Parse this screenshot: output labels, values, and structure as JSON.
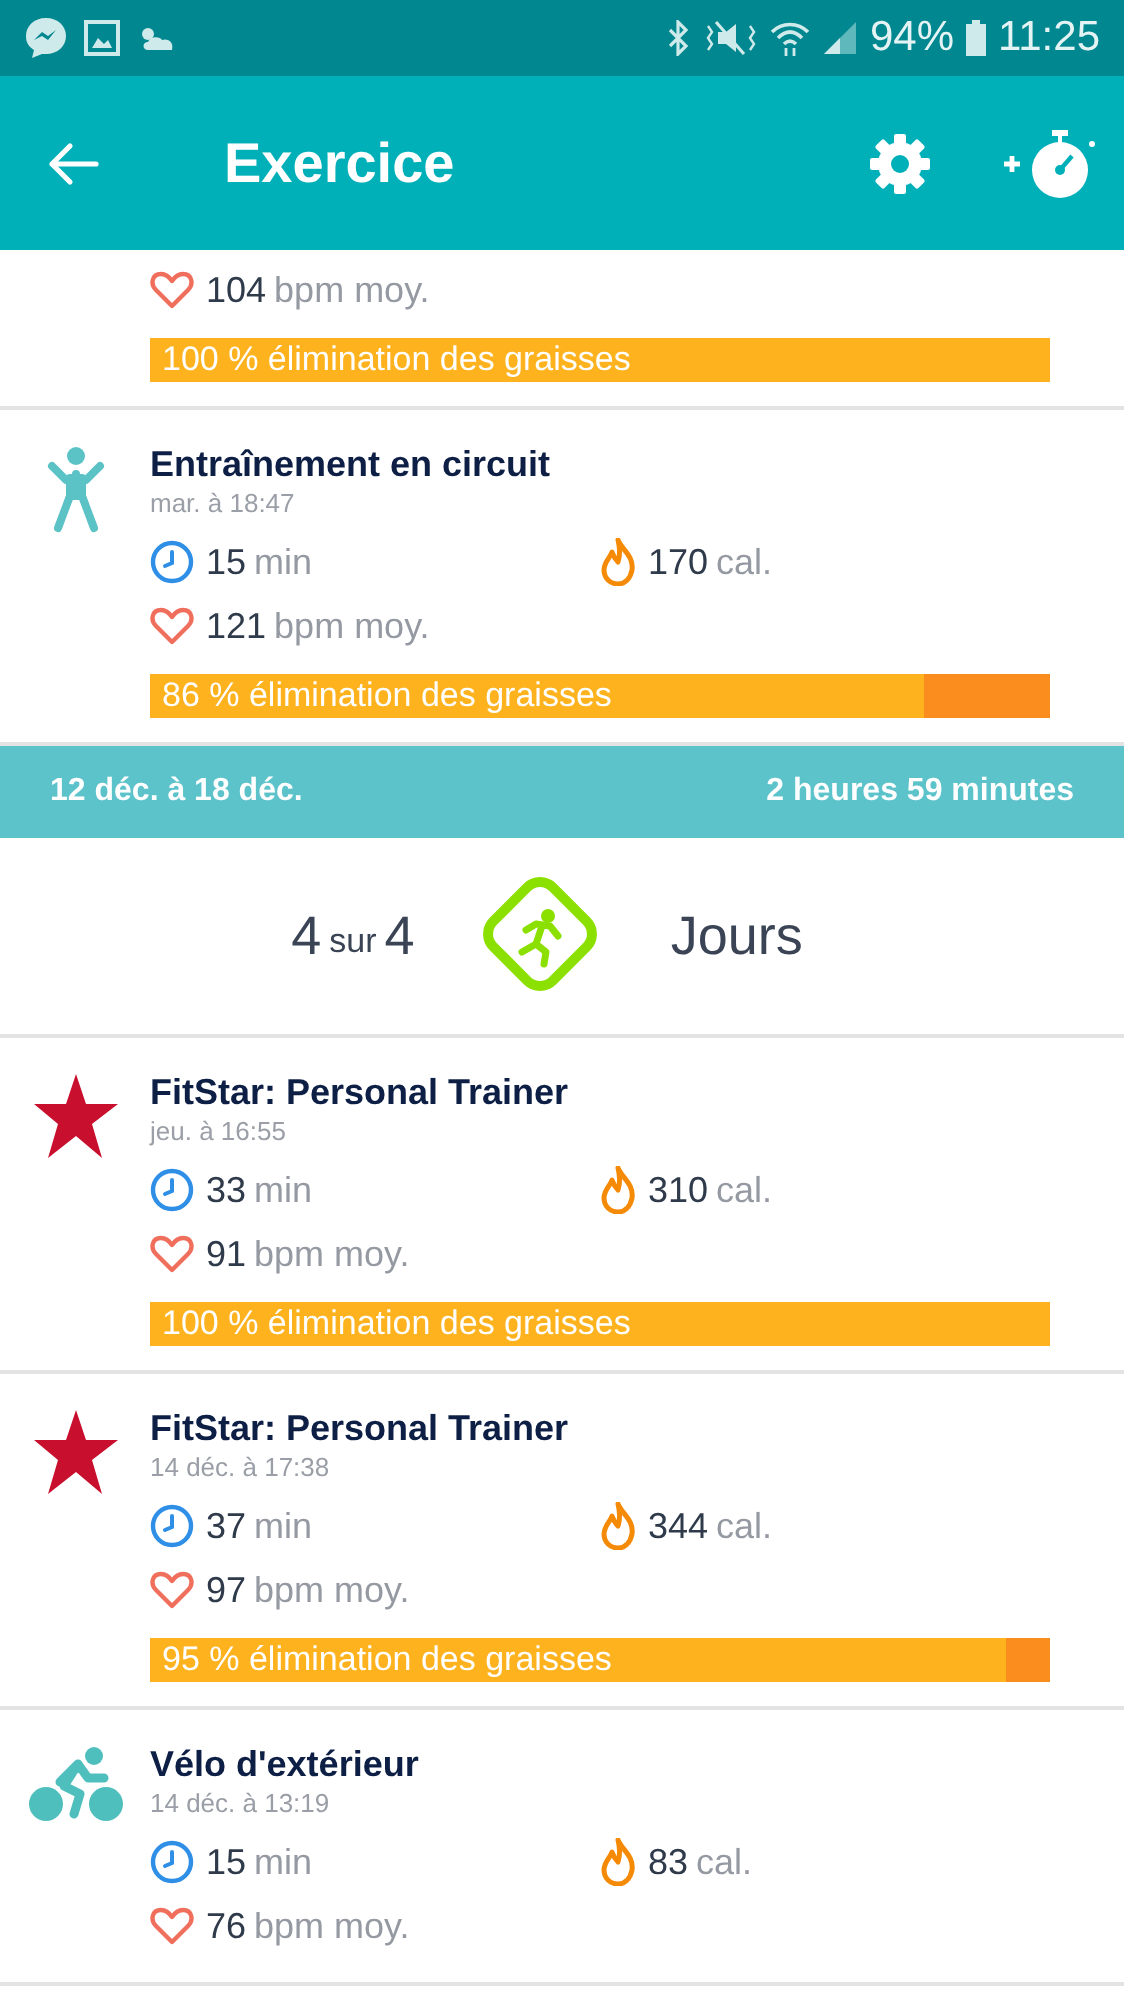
{
  "status_bar": {
    "battery_text": "94%",
    "time": "11:25"
  },
  "app_bar": {
    "title": "Exercice"
  },
  "items_before": [
    {
      "heart": {
        "value": "104",
        "unit": "bpm moy."
      },
      "fat_burn": {
        "text": "100 % élimination des graisses",
        "level": 1
      }
    },
    {
      "kind": "person",
      "title": "Entraînement en circuit",
      "date": "mar. à 18:47",
      "duration": {
        "value": "15",
        "unit": "min"
      },
      "calories": {
        "value": "170",
        "unit": "cal."
      },
      "heart": {
        "value": "121",
        "unit": "bpm moy."
      },
      "fat_burn": {
        "text": "86 % élimination des graisses",
        "level": 0.86
      }
    }
  ],
  "week": {
    "range": "12 déc. à 18 déc.",
    "total": "2 heures 59 minutes"
  },
  "streak": {
    "done": "4",
    "sep": "sur",
    "goal": "4",
    "unit": "Jours"
  },
  "items_after": [
    {
      "kind": "star",
      "title": "FitStar: Personal Trainer",
      "date": "jeu. à 16:55",
      "duration": {
        "value": "33",
        "unit": "min"
      },
      "calories": {
        "value": "310",
        "unit": "cal."
      },
      "heart": {
        "value": "91",
        "unit": "bpm moy."
      },
      "fat_burn": {
        "text": "100 % élimination des graisses",
        "level": 1
      }
    },
    {
      "kind": "star",
      "title": "FitStar: Personal Trainer",
      "date": "14 déc. à 17:38",
      "duration": {
        "value": "37",
        "unit": "min"
      },
      "calories": {
        "value": "344",
        "unit": "cal."
      },
      "heart": {
        "value": "97",
        "unit": "bpm moy."
      },
      "fat_burn": {
        "text": "95 % élimination des graisses",
        "level": 0.95
      }
    },
    {
      "kind": "bike",
      "title": "Vélo d'extérieur",
      "date": "14 déc. à 13:19",
      "duration": {
        "value": "15",
        "unit": "min"
      },
      "calories": {
        "value": "83",
        "unit": "cal."
      },
      "heart": {
        "value": "76",
        "unit": "bpm moy."
      }
    }
  ]
}
